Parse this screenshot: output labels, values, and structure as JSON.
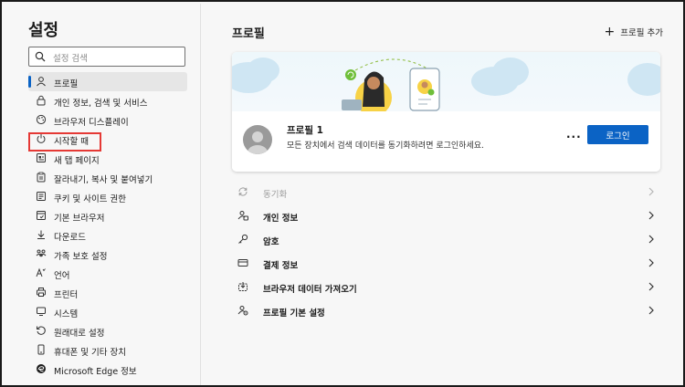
{
  "sidebar": {
    "title": "설정",
    "search_placeholder": "설정 검색",
    "items": [
      {
        "label": "프로필",
        "icon": "person-icon"
      },
      {
        "label": "개인 정보, 검색 및 서비스",
        "icon": "lock-icon"
      },
      {
        "label": "브라우저 디스플레이",
        "icon": "palette-icon"
      },
      {
        "label": "시작할 때",
        "icon": "power-icon"
      },
      {
        "label": "새 탭 페이지",
        "icon": "new-tab-icon"
      },
      {
        "label": "잘라내기, 복사 및 붙여넣기",
        "icon": "clipboard-icon"
      },
      {
        "label": "쿠키 및 사이트 권한",
        "icon": "cookie-icon"
      },
      {
        "label": "기본 브라우저",
        "icon": "browser-icon"
      },
      {
        "label": "다운로드",
        "icon": "download-icon"
      },
      {
        "label": "가족 보호 설정",
        "icon": "family-icon"
      },
      {
        "label": "언어",
        "icon": "language-icon"
      },
      {
        "label": "프린터",
        "icon": "printer-icon"
      },
      {
        "label": "시스템",
        "icon": "system-icon"
      },
      {
        "label": "원래대로 설정",
        "icon": "reset-icon"
      },
      {
        "label": "휴대폰 및 기타 장치",
        "icon": "phone-icon"
      },
      {
        "label": "Microsoft Edge 정보",
        "icon": "edge-icon"
      }
    ]
  },
  "main": {
    "title": "프로필",
    "add_profile_label": "프로필 추가",
    "profile": {
      "name": "프로필 1",
      "description": "모든 장치에서 검색 데이터를 동기화하려면 로그인하세요.",
      "login_label": "로그인",
      "more_label": "···"
    },
    "rows": [
      {
        "label": "동기화",
        "icon": "sync-icon",
        "disabled": true
      },
      {
        "label": "개인 정보",
        "icon": "personal-info-icon",
        "disabled": false
      },
      {
        "label": "암호",
        "icon": "key-icon",
        "disabled": false
      },
      {
        "label": "결제 정보",
        "icon": "card-icon",
        "disabled": false
      },
      {
        "label": "브라우저 데이터 가져오기",
        "icon": "import-icon",
        "disabled": false
      },
      {
        "label": "프로필 기본 설정",
        "icon": "profile-settings-icon",
        "disabled": false
      }
    ]
  },
  "colors": {
    "accent": "#0b63c5",
    "highlight": "#e53935"
  }
}
